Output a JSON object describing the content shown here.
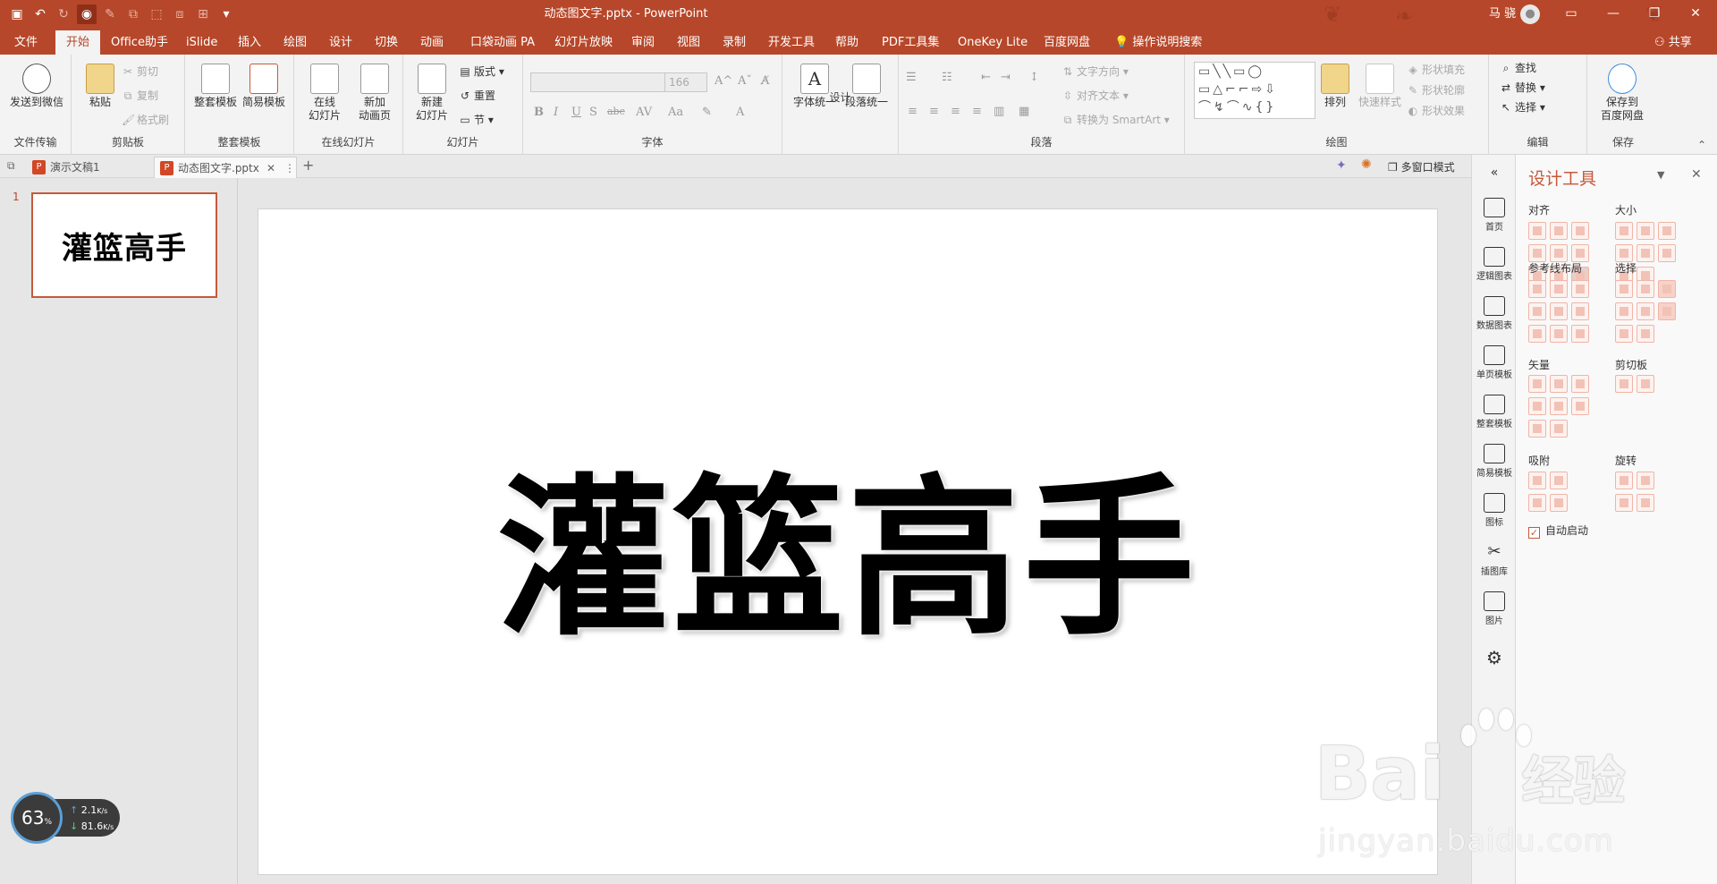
{
  "titlebar": {
    "title": "动态图文字.pptx  -  PowerPoint",
    "user_name": "马 骁",
    "window_controls": [
      "restore-window",
      "minimize",
      "maximize",
      "close"
    ]
  },
  "tabs": [
    {
      "label": "文件",
      "active": false
    },
    {
      "label": "开始",
      "active": true
    },
    {
      "label": "Office助手",
      "active": false
    },
    {
      "label": "iSlide",
      "active": false
    },
    {
      "label": "插入",
      "active": false
    },
    {
      "label": "绘图",
      "active": false
    },
    {
      "label": "设计",
      "active": false
    },
    {
      "label": "切换",
      "active": false
    },
    {
      "label": "动画",
      "active": false
    },
    {
      "label": "口袋动画 PA",
      "active": false
    },
    {
      "label": "幻灯片放映",
      "active": false
    },
    {
      "label": "审阅",
      "active": false
    },
    {
      "label": "视图",
      "active": false
    },
    {
      "label": "录制",
      "active": false
    },
    {
      "label": "开发工具",
      "active": false
    },
    {
      "label": "帮助",
      "active": false
    },
    {
      "label": "PDF工具集",
      "active": false
    },
    {
      "label": "OneKey Lite",
      "active": false
    },
    {
      "label": "百度网盘",
      "active": false
    }
  ],
  "tell_me": "操作说明搜索",
  "share": "共享",
  "ribbon": {
    "file_transfer": {
      "label": "文件传输",
      "send_wechat": "发送到微信"
    },
    "clipboard": {
      "label": "剪贴板",
      "paste": "粘贴",
      "cut": "剪切",
      "copy": "复制",
      "format_painter": "格式刷"
    },
    "templates": {
      "label": "整套模板",
      "full": "整套模板",
      "simple": "简易模板"
    },
    "online": {
      "label": "在线幻灯片",
      "online_slides": "在线\n幻灯片",
      "new_anim": "新加\n动画页"
    },
    "slides": {
      "label": "幻灯片",
      "new_slide": "新建\n幻灯片",
      "layout": "版式",
      "reset": "重置",
      "section": "节"
    },
    "font": {
      "label": "字体",
      "font_name": "",
      "font_size": "166"
    },
    "design": {
      "label": "设计",
      "font_unify": "字体统一",
      "para_unify": "段落统一"
    },
    "paragraph": {
      "label": "段落",
      "text_dir": "文字方向",
      "align_text": "对齐文本",
      "smartart": "转换为 SmartArt"
    },
    "drawing": {
      "label": "绘图",
      "arrange": "排列",
      "quick_styles": "快速样式",
      "shape_fill": "形状填充",
      "shape_outline": "形状轮廓",
      "shape_effect": "形状效果"
    },
    "editing": {
      "label": "编辑",
      "find": "查找",
      "replace": "替换",
      "select": "选择"
    },
    "save": {
      "label": "保存",
      "save_baidu": "保存到\n百度网盘"
    }
  },
  "doc_tabs": [
    {
      "label": "演示文稿1",
      "active": false
    },
    {
      "label": "动态图文字.pptx",
      "active": true
    }
  ],
  "multi_window": "多窗口模式",
  "slide_panel": {
    "number": "1",
    "thumb_text": "灌篮高手"
  },
  "slide": {
    "text": "灌篮高手"
  },
  "speed_widget": {
    "percent": "63",
    "percent_unit": "%",
    "up": "2.1",
    "down": "81.6",
    "unit": "K/s"
  },
  "side_nav": [
    "首页",
    "逻辑图表",
    "数据图表",
    "单页模板",
    "整套模板",
    "简易模板",
    "图标",
    "插图库",
    "图片"
  ],
  "design_panel": {
    "title": "设计工具",
    "sections": {
      "align": "对齐",
      "size": "大小",
      "guide_layout": "参考线布局",
      "select": "选择",
      "vector": "矢量",
      "clipboard": "剪切板",
      "snap": "吸附",
      "rotate": "旋转"
    },
    "auto_start": "自动启动",
    "auto_start_checked": true
  },
  "watermark": {
    "brand": "Bai",
    "brand_cn": "经验",
    "url": "jingyan.baidu.com"
  }
}
